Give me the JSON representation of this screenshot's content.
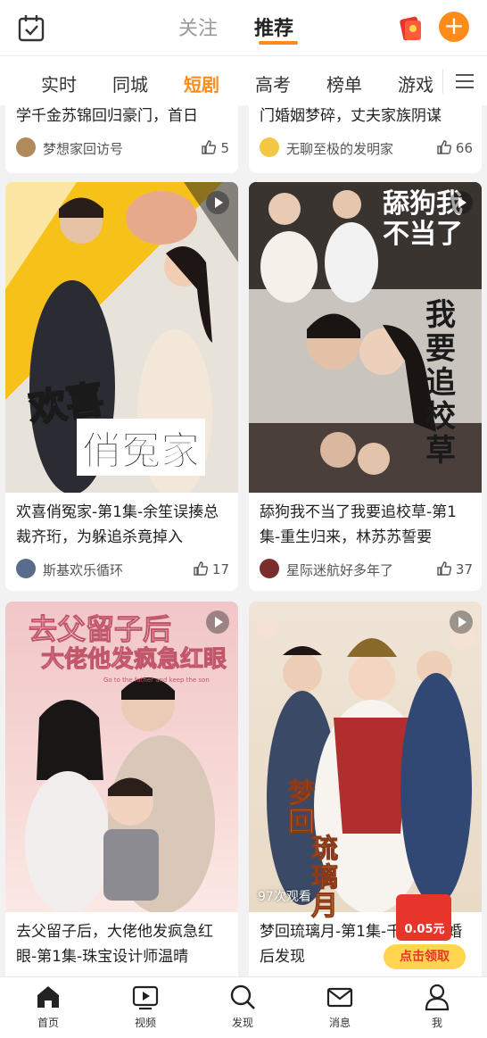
{
  "header": {
    "tabs": [
      {
        "label": "关注"
      },
      {
        "label": "推荐"
      }
    ]
  },
  "categories": [
    {
      "label": "实时"
    },
    {
      "label": "同城"
    },
    {
      "label": "短剧"
    },
    {
      "label": "高考"
    },
    {
      "label": "榜单"
    },
    {
      "label": "游戏"
    }
  ],
  "active_category": "短剧",
  "cards": [
    {
      "title": "学千金苏锦回归豪门，首日",
      "author": "梦想家回访号",
      "likes": "5"
    },
    {
      "title": "门婚姻梦碎，丈夫家族阴谋",
      "author": "无聊至极的发明家",
      "likes": "66"
    },
    {
      "title": "欢喜俏冤家-第1集-余笙误揍总裁齐珩，为躲追杀竟掉入",
      "author": "斯基欢乐循环",
      "likes": "17",
      "poster": {
        "line1": "欢喜",
        "line2": "俏冤家"
      }
    },
    {
      "title": "舔狗我不当了我要追校草-第1集-重生归来，林苏苏誓要",
      "author": "星际迷航好多年了",
      "likes": "37",
      "poster": {
        "line1": "舔狗我不当了",
        "line2": "我要追校草"
      }
    },
    {
      "title": "去父留子后，大佬他发疯急红眼-第1集-珠宝设计师温晴",
      "author": "",
      "likes": "",
      "poster": {
        "line1": "去父留子后",
        "line2": "大佬他发疯急红眼",
        "small": "Go to the father and keep the son"
      }
    },
    {
      "title": "梦回琉璃月-第1集-千金李荷婚后发现",
      "author": "",
      "likes": "",
      "views": "97次观看",
      "poster": {
        "line1": "梦回",
        "line2": "琉璃月"
      }
    }
  ],
  "reward": {
    "amount": "0.05元",
    "claim_label": "点击领取"
  },
  "bottom_nav": [
    {
      "label": "首页",
      "icon": "home-icon"
    },
    {
      "label": "视频",
      "icon": "video-icon"
    },
    {
      "label": "发现",
      "icon": "search-icon"
    },
    {
      "label": "消息",
      "icon": "mail-icon"
    },
    {
      "label": "我",
      "icon": "user-icon"
    }
  ],
  "colors": {
    "accent": "#ff8c1a",
    "red": "#e8352b"
  }
}
